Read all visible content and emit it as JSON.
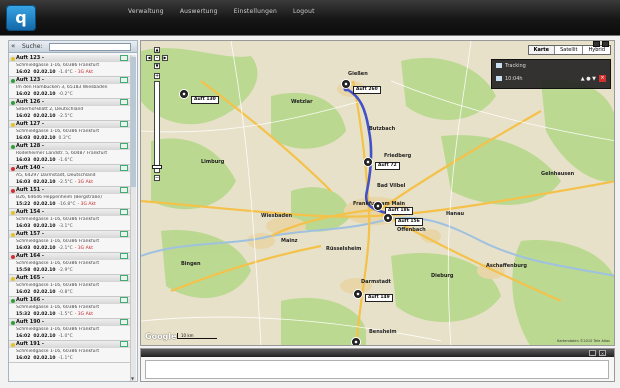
{
  "app": {
    "logo_text": "q",
    "nav": [
      "Verwaltung",
      "Auswertung",
      "Einstellungen",
      "Logout"
    ]
  },
  "sidebar": {
    "collapse_label": "«",
    "search_label": "Suche:",
    "search_value": "",
    "vehicles": [
      {
        "name": "Auft 123 -",
        "status": "yellow",
        "address": "Schmiedgasse 1-16, 60386 Frankfurt",
        "time": "16:02",
        "date": "02.02.10",
        "temp": "-1.4°C",
        "state": "- 3G Akt"
      },
      {
        "name": "Auft 123 -",
        "status": "green",
        "address": "Im den Hambücken 3, 65183 Wiesbaden",
        "time": "16:02",
        "date": "02.02.10",
        "temp": "-0.2°C",
        "state": ""
      },
      {
        "name": "Auft 126 -",
        "status": "green",
        "address": "Silberhof-Blatt 2, Deutschland",
        "time": "16:02",
        "date": "02.02.10",
        "temp": "-2.5°C",
        "state": ""
      },
      {
        "name": "Auft 127 -",
        "status": "yellow",
        "address": "Schmiedgasse 1-16, 60386 Frankfurt",
        "time": "16:03",
        "date": "02.02.10",
        "temp": "0.3°C",
        "state": ""
      },
      {
        "name": "Auft 128 -",
        "status": "green",
        "address": "Rödelheimer Landstr. 5, 60487 Frankfurt",
        "time": "16:03",
        "date": "02.02.10",
        "temp": "-1.6°C",
        "state": ""
      },
      {
        "name": "Auft 140 -",
        "status": "red",
        "address": "A5, 64297 Darmstadt, Deutschland",
        "time": "16:03",
        "date": "02.02.10",
        "temp": "-2.5°C",
        "state": "- 3G Akt"
      },
      {
        "name": "Auft 151 -",
        "status": "red",
        "address": "B26, 64646 Heppenheim (Bergstraße)",
        "time": "15:22",
        "date": "02.02.10",
        "temp": "-16.8°C",
        "state": "- 3G Akt"
      },
      {
        "name": "Auft 154 -",
        "status": "yellow",
        "address": "Schmiedgasse 1-16, 60386 Frankfurt",
        "time": "16:03",
        "date": "02.02.10",
        "temp": "-3.1°C",
        "state": ""
      },
      {
        "name": "Auft 157 -",
        "status": "yellow",
        "address": "Schmiedgasse 1-16, 60386 Frankfurt",
        "time": "16:03",
        "date": "02.02.10",
        "temp": "-2.1°C",
        "state": "- 3G Akt"
      },
      {
        "name": "Auft 164 -",
        "status": "red",
        "address": "Schmiedgasse 1-16, 60386 Frankfurt",
        "time": "15:58",
        "date": "02.02.10",
        "temp": "-2.9°C",
        "state": ""
      },
      {
        "name": "Auft 165 -",
        "status": "yellow",
        "address": "Schmiedgasse 1-16, 60386 Frankfurt",
        "time": "16:02",
        "date": "02.02.10",
        "temp": "-0.8°C",
        "state": ""
      },
      {
        "name": "Auft 166 -",
        "status": "green",
        "address": "Schmiedgasse 1-16, 60386 Frankfurt",
        "time": "15:32",
        "date": "02.02.10",
        "temp": "-1.5°C",
        "state": "- 3G Akt"
      },
      {
        "name": "Auft 190 -",
        "status": "green",
        "address": "Schmiedgasse 1-16, 60386 Frankfurt",
        "time": "16:02",
        "date": "02.02.10",
        "temp": "-1.0°C",
        "state": ""
      },
      {
        "name": "Auft 191 -",
        "status": "yellow",
        "address": "Schmiedgasse 1-16, 60386 Frankfurt",
        "time": "16:02",
        "date": "02.02.10",
        "temp": "-1.1°C",
        "state": ""
      }
    ]
  },
  "map": {
    "type_buttons": [
      "Karte",
      "Satellit",
      "Hybrid"
    ],
    "active_type": "Karte",
    "google_label": "Google",
    "scale_label": "10 km",
    "copyright": "Kartendaten ©2010 Tele Atlas",
    "tracking": {
      "title": "Tracking",
      "row2": "10:04h",
      "close": "×"
    },
    "places": [
      {
        "name": "Gießen"
      },
      {
        "name": "Wetzlar"
      },
      {
        "name": "Limburg"
      },
      {
        "name": "Friedberg"
      },
      {
        "name": "Bad Vilbel"
      },
      {
        "name": "Frankfurt am Main"
      },
      {
        "name": "Offenbach"
      },
      {
        "name": "Wiesbaden"
      },
      {
        "name": "Mainz"
      },
      {
        "name": "Hanau"
      },
      {
        "name": "Darmstadt"
      },
      {
        "name": "Aschaffenburg"
      },
      {
        "name": "Rüsselsheim"
      },
      {
        "name": "Bingen"
      },
      {
        "name": "Butzbach"
      },
      {
        "name": "Dieburg"
      },
      {
        "name": "Bensheim"
      },
      {
        "name": "Gelnhausen"
      }
    ],
    "markers": [
      {
        "label": "Auft 130"
      },
      {
        "label": "Auft 260"
      },
      {
        "label": "Auft 72"
      },
      {
        "label": "Auft 186"
      },
      {
        "label": "Auft 156"
      },
      {
        "label": "Auft 149"
      }
    ]
  },
  "bottom_panel": {
    "minimize": "_",
    "close": "×"
  },
  "colors": {
    "status_green": "#2e9d3a",
    "status_yellow": "#e2c12a",
    "status_red": "#d32f2f",
    "route": "#4251c7",
    "header": "#161616"
  }
}
